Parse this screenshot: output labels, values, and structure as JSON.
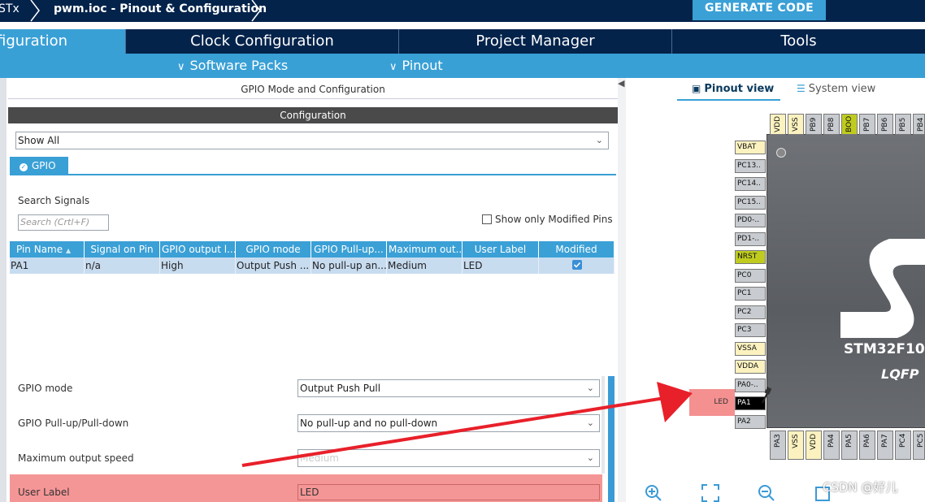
{
  "breadcrumb": {
    "item1": "STx",
    "item2": "pwm.ioc - Pinout & Configuration"
  },
  "toolbar": {
    "generate_label": "GENERATE CODE"
  },
  "tabs": [
    {
      "label": "Pinout & Configuration",
      "shown": "figuration"
    },
    {
      "label": "Clock Configuration"
    },
    {
      "label": "Project Manager"
    },
    {
      "label": "Tools"
    }
  ],
  "subbar": {
    "software_packs": "Software Packs",
    "pinout": "Pinout"
  },
  "panel": {
    "title": "GPIO Mode and Configuration",
    "config_header": "Configuration",
    "filter_value": "Show All",
    "gpio_tab": "GPIO",
    "search_label": "Search Signals",
    "search_placeholder": "Search (Crtl+F)",
    "show_modified_label": "Show only Modified Pins",
    "show_modified_checked": false
  },
  "table": {
    "headers": [
      "Pin Name",
      "Signal on Pin",
      "GPIO output l...",
      "GPIO mode",
      "GPIO Pull-up...",
      "Maximum out...",
      "User Label",
      "Modified"
    ],
    "rows": [
      {
        "pin": "PA1",
        "signal": "n/a",
        "output": "High",
        "mode": "Output Push ...",
        "pull": "No pull-up an...",
        "speed": "Medium",
        "label": "LED",
        "modified": true
      }
    ]
  },
  "properties": {
    "gpio_mode_label": "GPIO mode",
    "gpio_mode_value": "Output Push Pull",
    "pull_label": "GPIO Pull-up/Pull-down",
    "pull_value": "No pull-up and no pull-down",
    "speed_label": "Maximum output speed",
    "speed_value": "Medium",
    "user_label_label": "User Label",
    "user_label_value": "LED"
  },
  "view_tabs": {
    "pinout": "Pinout view",
    "system": "System view"
  },
  "chip": {
    "name": "STM32F10",
    "package": "LQFP",
    "top_pins": [
      "VDD",
      "VSS",
      "PB9",
      "PB8",
      "BOO",
      "PB7",
      "PB6",
      "PB5",
      "PB4"
    ],
    "left_pins": [
      "VBAT",
      "PC13..",
      "PC14..",
      "PC15..",
      "PD0-..",
      "PD1-..",
      "NRST",
      "PC0",
      "PC1",
      "PC2",
      "PC3",
      "VSSA",
      "VDDA",
      "PA0-..",
      "PA1",
      "PA2"
    ],
    "bottom_pins": [
      "PA3",
      "VSS",
      "VDD",
      "PA4",
      "PA5",
      "PA6",
      "PA7",
      "PC4",
      "PC5"
    ],
    "pin_led_label": "LED"
  },
  "colors": {
    "accent": "#39a0d6",
    "nav": "#03234b",
    "highlight": "#f49090",
    "power_pin": "#fbf2c0",
    "boot_pin": "#bfcc1f"
  },
  "watermark": "CSDN @好儿"
}
